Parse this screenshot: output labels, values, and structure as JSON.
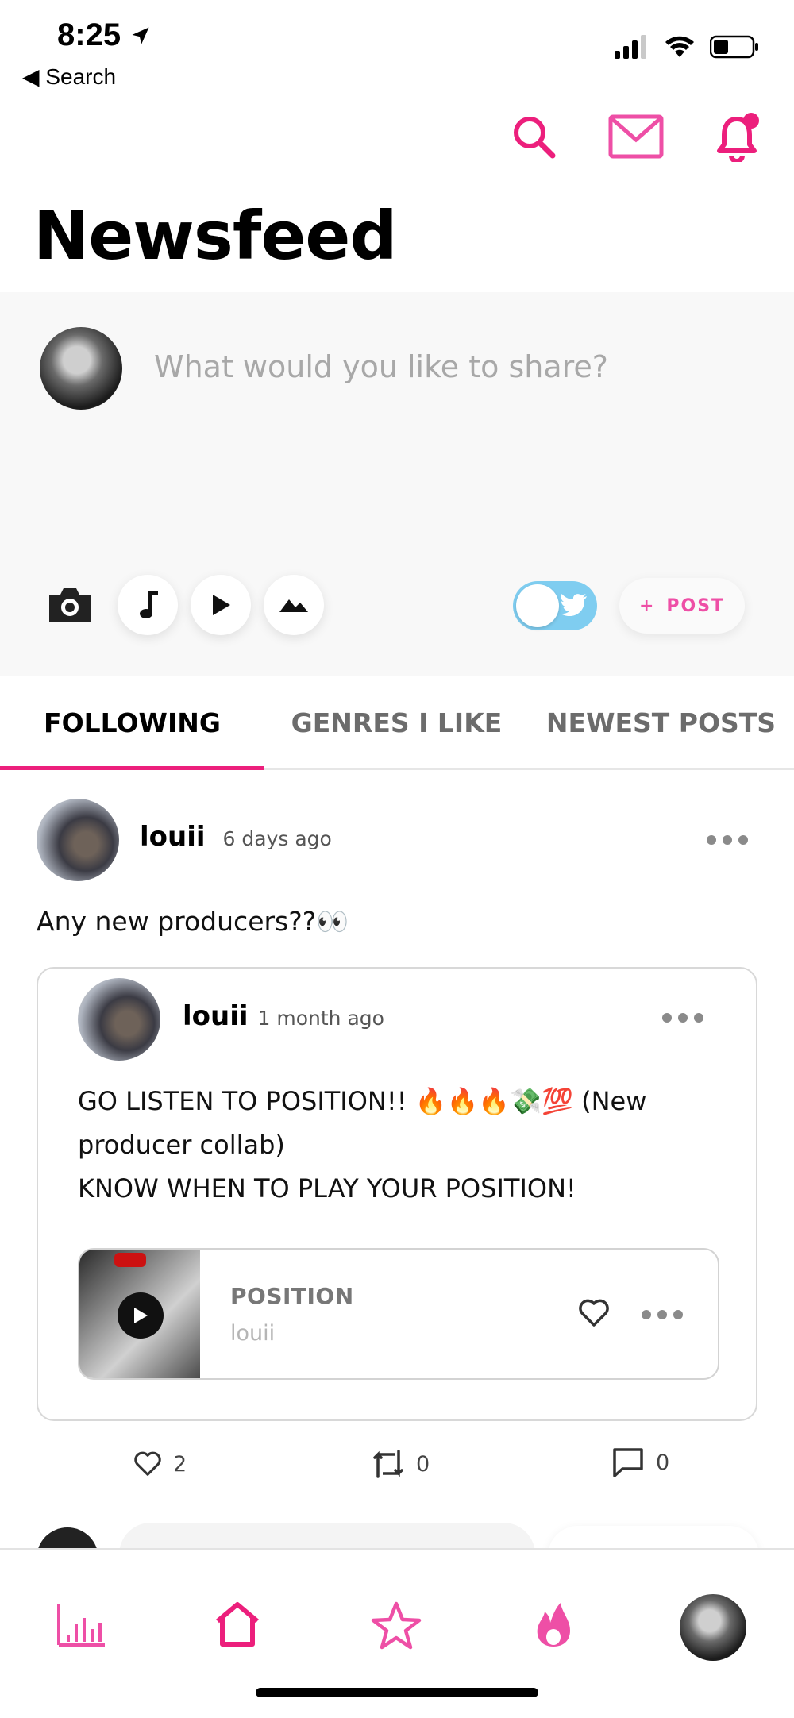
{
  "status_bar": {
    "time": "8:25",
    "back_label": "Search"
  },
  "header": {
    "title": "Newsfeed",
    "icons": [
      "search-icon",
      "mail-icon",
      "bell-icon"
    ],
    "notification_dot": true
  },
  "composer": {
    "placeholder": "What would you like to share?",
    "media_buttons": [
      "camera-icon",
      "music-note-icon",
      "play-icon",
      "image-icon"
    ],
    "twitter_toggle_on": true,
    "post_label": "POST",
    "post_prefix": "+"
  },
  "tabs": [
    {
      "label": "FOLLOWING",
      "active": true
    },
    {
      "label": "GENRES I LIKE",
      "active": false
    },
    {
      "label": "NEWEST POSTS",
      "active": false
    }
  ],
  "post": {
    "user": "louii",
    "time": "6 days ago",
    "text": "Any new producers??👀",
    "quoted": {
      "user": "louii",
      "time": "1 month ago",
      "line1": "GO LISTEN TO POSITION!! 🔥🔥🔥💸💯 (New producer collab)",
      "line2": "KNOW WHEN TO PLAY YOUR POSITION!",
      "track": {
        "title": "POSITION",
        "artist": "louii"
      }
    },
    "likes": "2",
    "reposts": "0",
    "comments": "0"
  },
  "bottom_nav": {
    "items": [
      "chart-icon",
      "home-icon",
      "star-icon",
      "flame-icon",
      "profile-avatar"
    ],
    "active": "home-icon"
  },
  "colors": {
    "accent": "#EC1F7C",
    "accent_light": "#EE4FA6",
    "twitter": "#7FCDF0"
  }
}
